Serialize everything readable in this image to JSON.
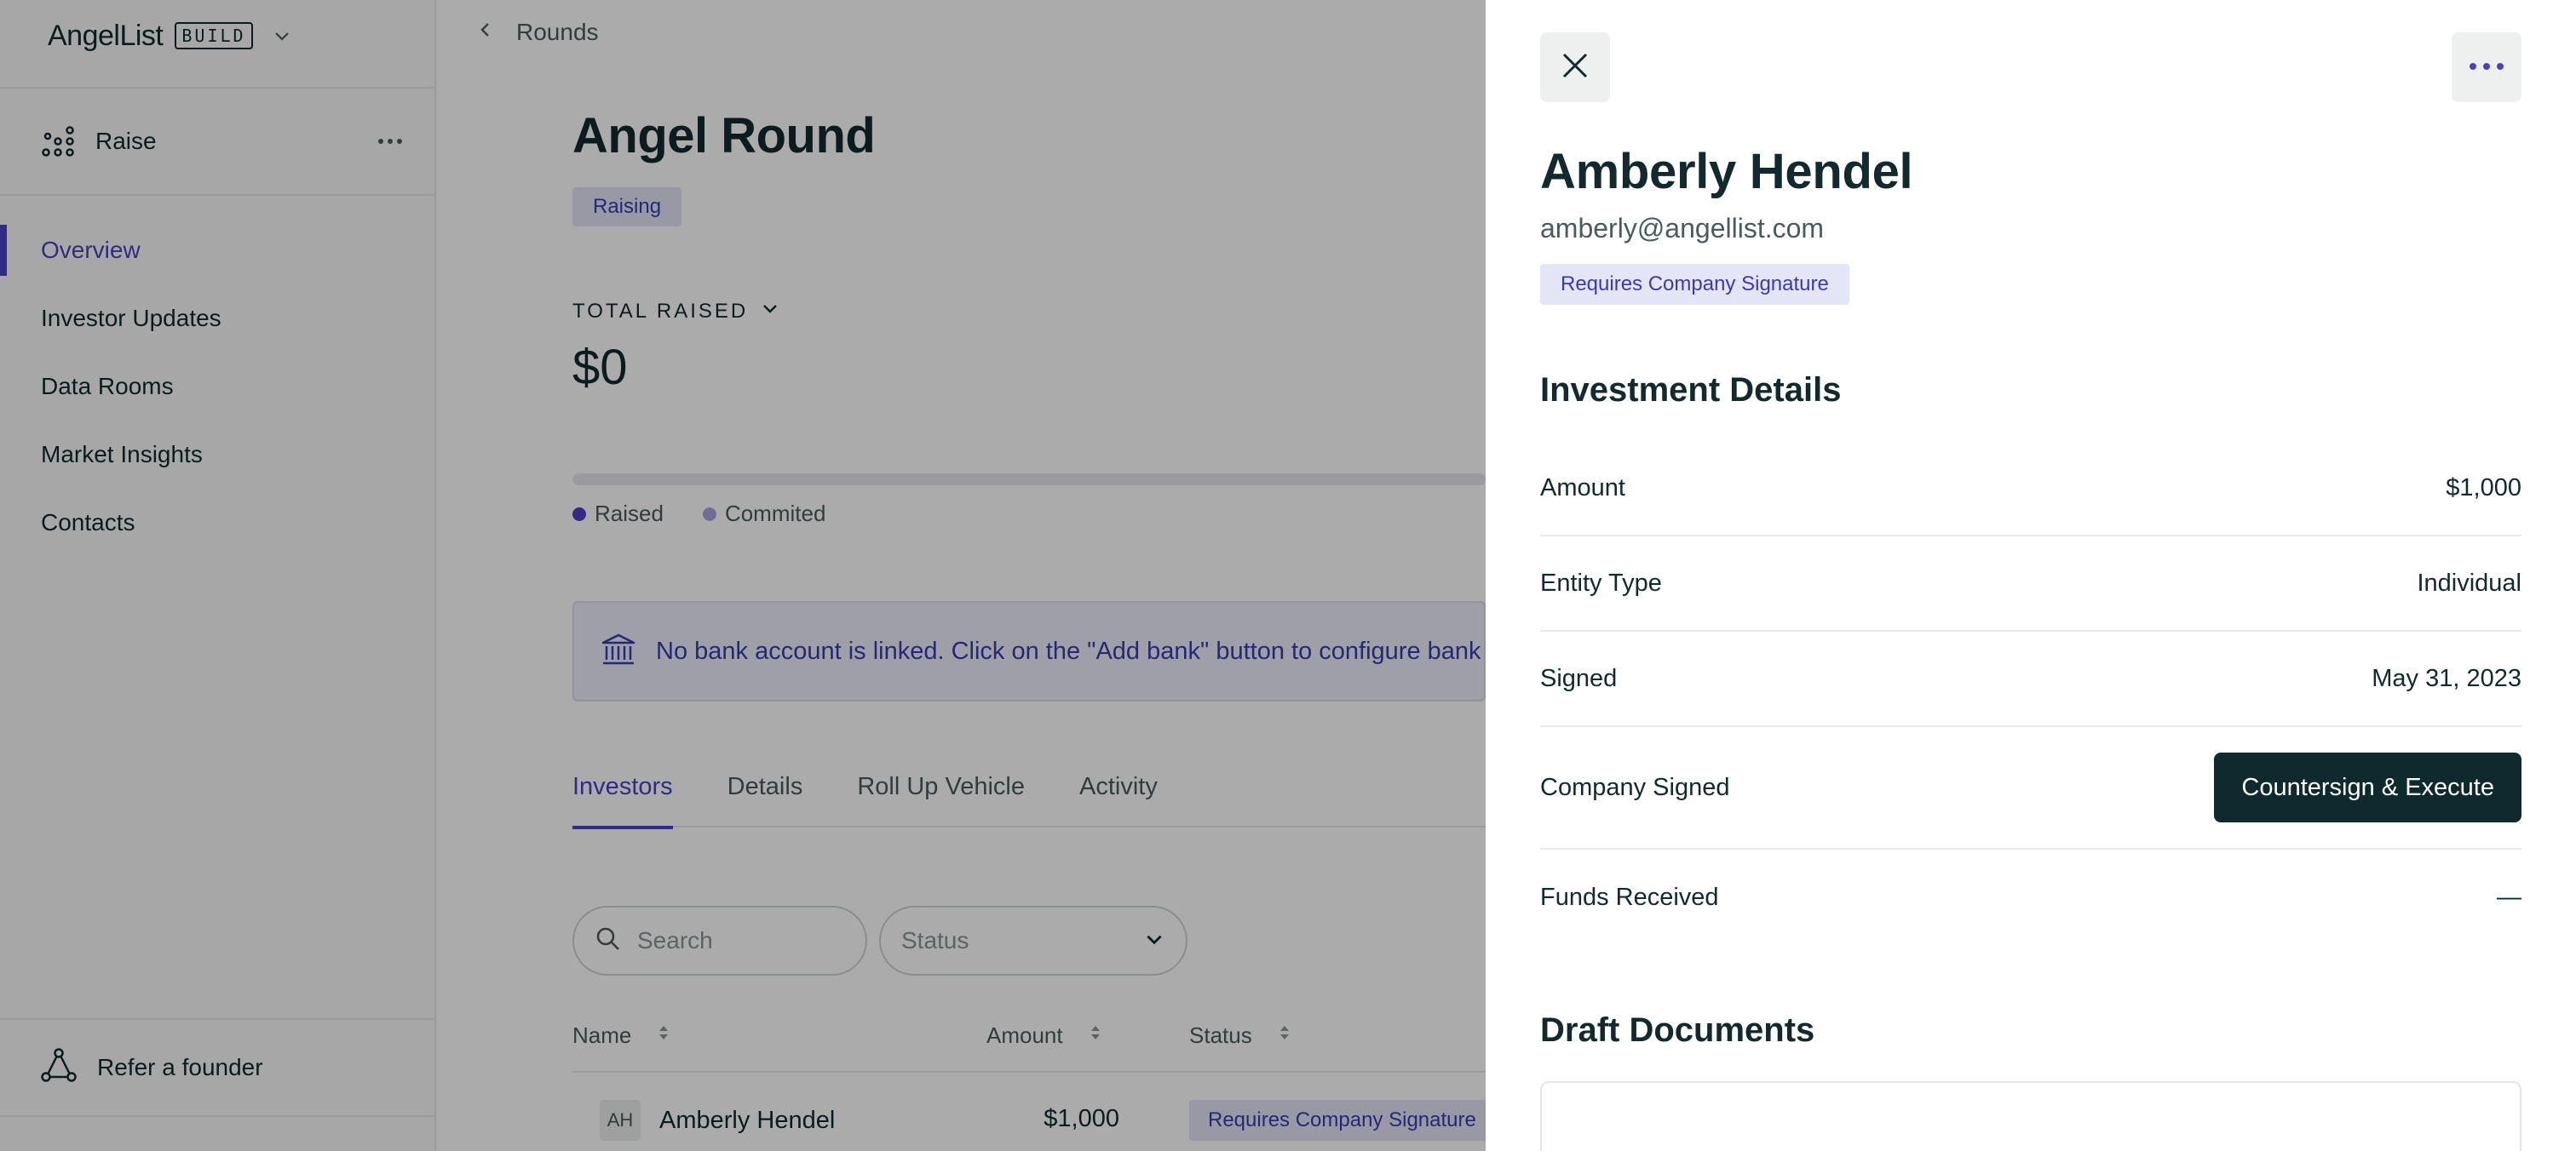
{
  "sidebar": {
    "brand_name": "AngelList",
    "brand_badge": "BUILD",
    "section_label": "Raise",
    "nav": [
      {
        "label": "Overview",
        "active": true
      },
      {
        "label": "Investor Updates"
      },
      {
        "label": "Data Rooms"
      },
      {
        "label": "Market Insights"
      },
      {
        "label": "Contacts"
      }
    ],
    "refer_label": "Refer a founder"
  },
  "main": {
    "breadcrumb": "Rounds",
    "title": "Angel Round",
    "status_badge": "Raising",
    "total_raised_label": "TOTAL RAISED",
    "total_raised_value": "$0",
    "progress_fraction": 0.0,
    "legend": [
      {
        "label": "Raised",
        "color": "#4b40c8"
      },
      {
        "label": "Commited",
        "color": "#a9a3e4"
      }
    ],
    "alert_text": "No bank account is linked. Click on the \"Add bank\" button to configure bank d",
    "tabs": [
      {
        "label": "Investors",
        "active": true
      },
      {
        "label": "Details"
      },
      {
        "label": "Roll Up Vehicle"
      },
      {
        "label": "Activity"
      }
    ],
    "search_placeholder": "Search",
    "status_placeholder": "Status",
    "columns": {
      "name": "Name",
      "amount": "Amount",
      "status": "Status"
    },
    "rows": [
      {
        "initials": "AH",
        "name": "Amberly Hendel",
        "amount": "$1,000",
        "status": "Requires Company Signature"
      }
    ]
  },
  "drawer": {
    "name": "Amberly Hendel",
    "email": "amberly@angellist.com",
    "badge": "Requires Company Signature",
    "investment_heading": "Investment Details",
    "details": {
      "amount": {
        "label": "Amount",
        "value": "$1,000"
      },
      "entity_type": {
        "label": "Entity Type",
        "value": "Individual"
      },
      "signed": {
        "label": "Signed",
        "value": "May 31, 2023"
      },
      "company_signed": {
        "label": "Company Signed",
        "action": "Countersign & Execute"
      },
      "funds_received": {
        "label": "Funds Received",
        "value": "—"
      }
    },
    "documents_heading": "Draft Documents"
  },
  "colors": {
    "accent": "#4b40c8",
    "dark": "#0f2a2e",
    "badge_bg": "#e4e5f7",
    "badge_text": "#3b3ab4"
  }
}
